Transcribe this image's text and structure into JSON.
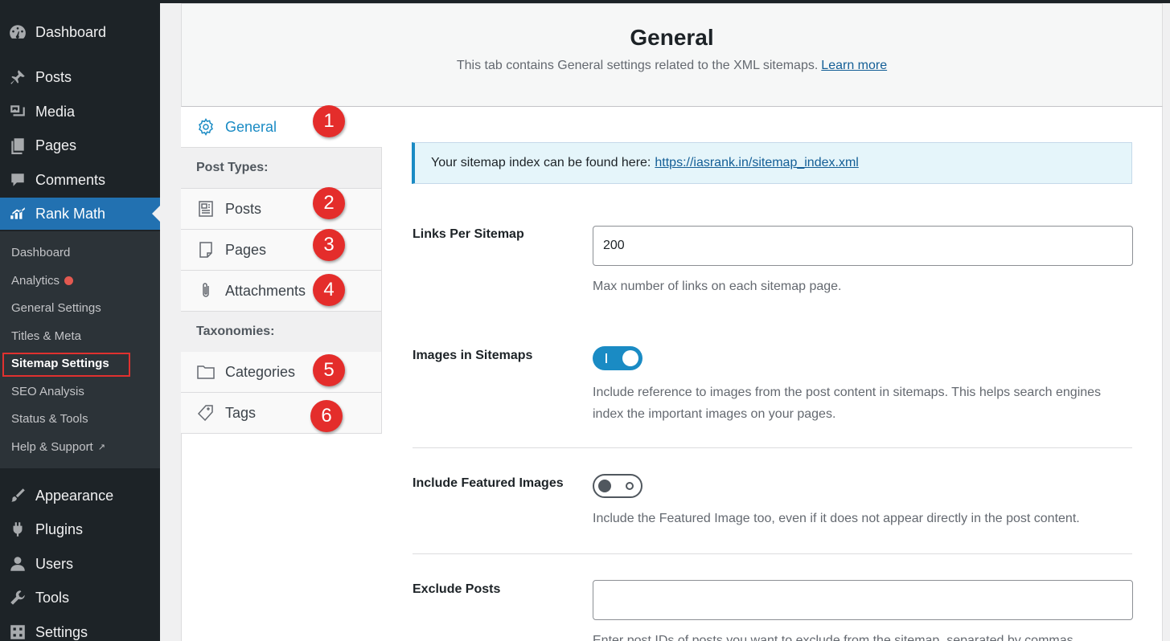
{
  "sidebar": {
    "menu": [
      {
        "label": "Dashboard",
        "icon": "dashboard-icon"
      },
      {
        "label": "Posts",
        "icon": "pin-icon"
      },
      {
        "label": "Media",
        "icon": "media-icon"
      },
      {
        "label": "Pages",
        "icon": "pages-icon"
      },
      {
        "label": "Comments",
        "icon": "comment-icon"
      },
      {
        "label": "Rank Math",
        "icon": "rank-math-icon"
      },
      {
        "label": "Appearance",
        "icon": "brush-icon"
      },
      {
        "label": "Plugins",
        "icon": "plugin-icon"
      },
      {
        "label": "Users",
        "icon": "user-icon"
      },
      {
        "label": "Tools",
        "icon": "wrench-icon"
      },
      {
        "label": "Settings",
        "icon": "settings-icon"
      }
    ],
    "submenu": [
      {
        "label": "Dashboard"
      },
      {
        "label": "Analytics"
      },
      {
        "label": "General Settings"
      },
      {
        "label": "Titles & Meta"
      },
      {
        "label": "Sitemap Settings"
      },
      {
        "label": "SEO Analysis"
      },
      {
        "label": "Status & Tools"
      },
      {
        "label": "Help & Support"
      }
    ]
  },
  "header": {
    "title": "General",
    "description": "This tab contains General settings related to the XML sitemaps.",
    "learn_more": "Learn more"
  },
  "tabs": {
    "general": "General",
    "post_types_heading": "Post Types:",
    "posts": "Posts",
    "pages": "Pages",
    "attachments": "Attachments",
    "taxonomies_heading": "Taxonomies:",
    "categories": "Categories",
    "tags": "Tags"
  },
  "badges": [
    "1",
    "2",
    "3",
    "4",
    "5",
    "6"
  ],
  "notice": {
    "text": "Your sitemap index can be found here:",
    "link": "https://iasrank.in/sitemap_index.xml"
  },
  "fields": {
    "links_per_sitemap": {
      "label": "Links Per Sitemap",
      "value": "200",
      "help": "Max number of links on each sitemap page."
    },
    "images_in_sitemaps": {
      "label": "Images in Sitemaps",
      "enabled": true,
      "help": "Include reference to images from the post content in sitemaps. This helps search engines index the important images on your pages."
    },
    "include_featured_images": {
      "label": "Include Featured Images",
      "enabled": false,
      "help": "Include the Featured Image too, even if it does not appear directly in the post content."
    },
    "exclude_posts": {
      "label": "Exclude Posts",
      "value": "",
      "help": "Enter post IDs of posts you want to exclude from the sitemap, separated by commas."
    }
  },
  "colors": {
    "accent": "#1a8bc4",
    "admin_active": "#2271b1",
    "badge": "#e42d2b",
    "highlight_box": "#e0312f"
  }
}
